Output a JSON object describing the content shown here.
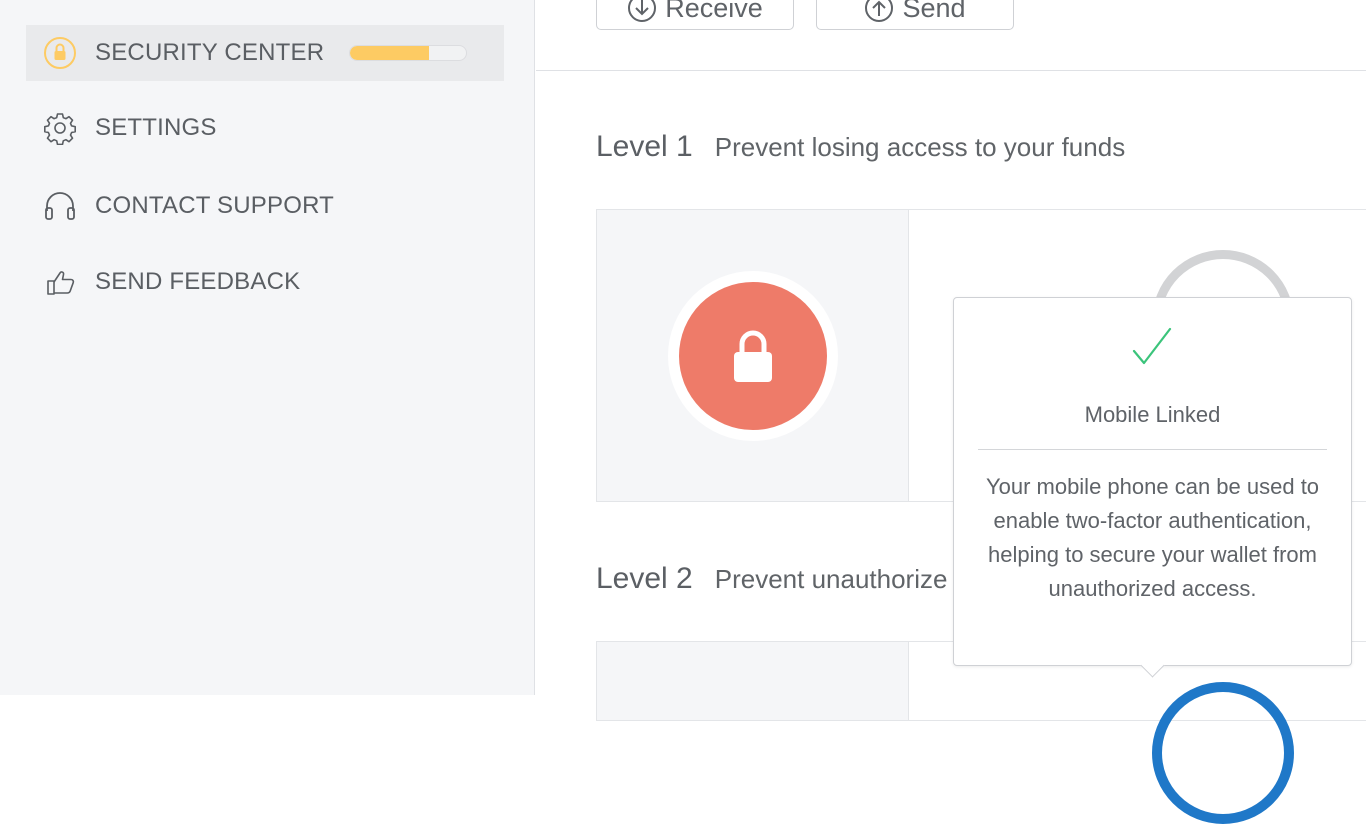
{
  "sidebar": {
    "items": [
      {
        "label": "SECURITY CENTER",
        "icon": "lock-icon",
        "active": true,
        "progress": 0.68
      },
      {
        "label": "SETTINGS",
        "icon": "gear-icon"
      },
      {
        "label": "CONTACT SUPPORT",
        "icon": "headset-icon"
      },
      {
        "label": "SEND FEEDBACK",
        "icon": "thumbs-up-icon"
      }
    ]
  },
  "toolbar": {
    "receive_label": "Receive",
    "send_label": "Send"
  },
  "levels": [
    {
      "number": "Level 1",
      "description": "Prevent losing access to your funds"
    },
    {
      "number": "Level 2",
      "description": "Prevent unauthorize"
    }
  ],
  "tooltip": {
    "title": "Mobile Linked",
    "body": "Your mobile phone can be used to enable two-factor authentication, helping to secure your wallet from unauthorized access."
  },
  "colors": {
    "accent_yellow": "#fdcb63",
    "lock_red": "#ee7b69",
    "check_green": "#3bc47b",
    "ring_blue": "#1f78c8"
  }
}
